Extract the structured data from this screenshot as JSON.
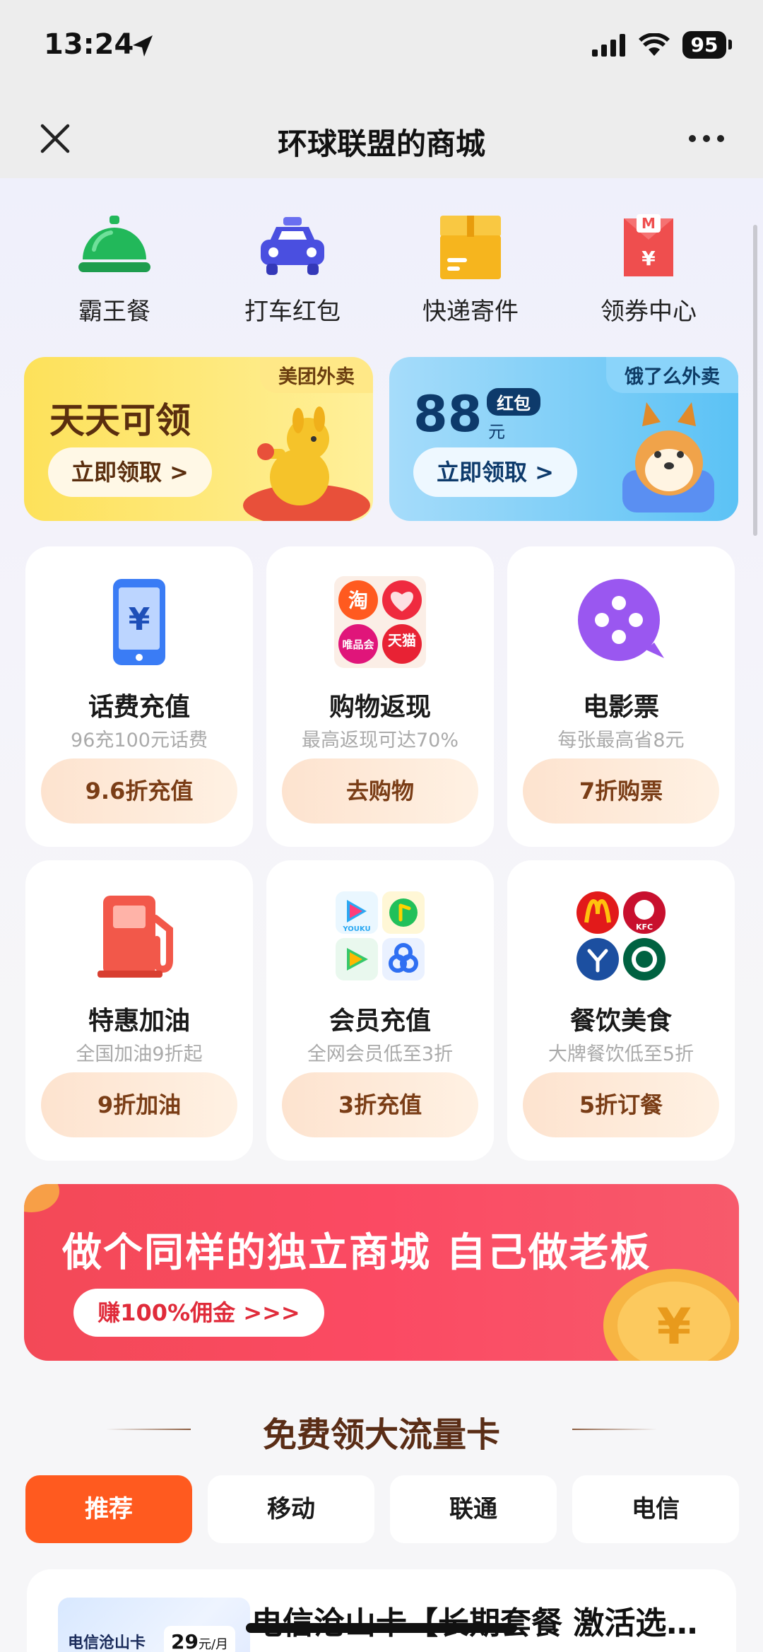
{
  "status_bar": {
    "time": "13:24",
    "battery": "95"
  },
  "nav": {
    "title": "环球联盟的商城"
  },
  "quick_links": [
    {
      "label": "霸王餐",
      "icon": "food-cloche-icon",
      "color": "#22b85a"
    },
    {
      "label": "打车红包",
      "icon": "taxi-icon",
      "color": "#4a4fe0"
    },
    {
      "label": "快递寄件",
      "icon": "package-icon",
      "color": "#f6b51e"
    },
    {
      "label": "领券中心",
      "icon": "coupon-icon",
      "color": "#ef4e4e"
    }
  ],
  "banners": {
    "meituan": {
      "tag": "美团外卖",
      "headline": "天天可领",
      "cta": "立即领取 >"
    },
    "eleme": {
      "tag": "饿了么外卖",
      "amount": "88",
      "badge": "红包",
      "unit": "元",
      "cta": "立即领取 >"
    }
  },
  "cards": [
    {
      "title": "话费充值",
      "subtitle": "96充100元话费",
      "button": "9.6折充值",
      "icon": "phone-yuan-icon"
    },
    {
      "title": "购物返现",
      "subtitle": "最高返现可达70%",
      "button": "去购物",
      "icon": "shopping-apps-icon",
      "apps": [
        "淘",
        "唯品会",
        "天猫"
      ]
    },
    {
      "title": "电影票",
      "subtitle": "每张最高省8元",
      "button": "7折购票",
      "icon": "film-reel-icon"
    },
    {
      "title": "特惠加油",
      "subtitle": "全国加油9折起",
      "button": "9折加油",
      "icon": "fuel-pump-icon"
    },
    {
      "title": "会员充值",
      "subtitle": "全网会员低至3折",
      "button": "3折充值",
      "icon": "video-apps-icon",
      "apps": [
        "YOUKU"
      ]
    },
    {
      "title": "餐饮美食",
      "subtitle": "大牌餐饮低至5折",
      "button": "5折订餐",
      "icon": "restaurant-logos-icon",
      "apps": [
        "KFC"
      ]
    }
  ],
  "promo": {
    "title": "做个同样的独立商城 自己做老板",
    "button": "赚100%佣金 >>>"
  },
  "section": {
    "title": "免费领大流量卡"
  },
  "tabs": [
    {
      "label": "推荐",
      "active": true
    },
    {
      "label": "移动",
      "active": false
    },
    {
      "label": "联通",
      "active": false
    },
    {
      "label": "电信",
      "active": false
    }
  ],
  "product": {
    "title": "电信沧山卡【长期套餐 激活选…",
    "thumb_label": "电信沧山卡",
    "thumb_price": "29",
    "thumb_price_unit": "元/月"
  }
}
